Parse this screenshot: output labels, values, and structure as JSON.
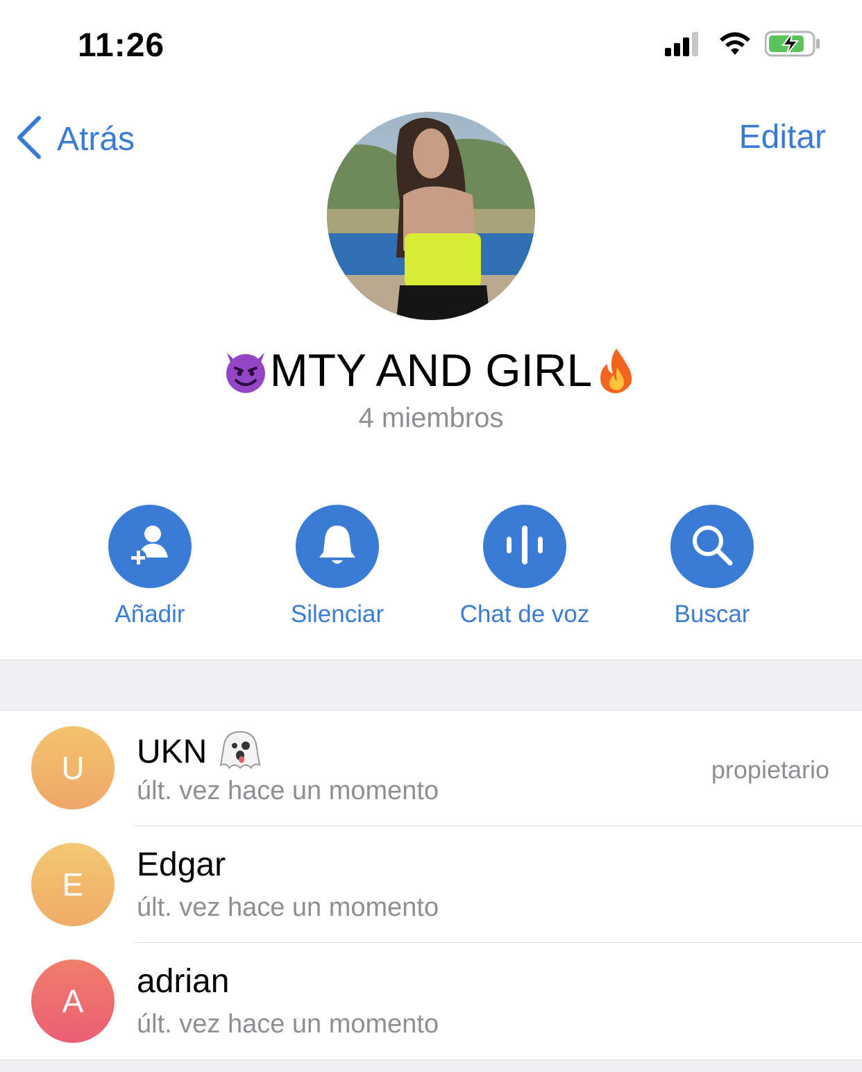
{
  "status_bar": {
    "time": "11:26"
  },
  "nav": {
    "back_label": "Atrás",
    "edit_label": "Editar"
  },
  "group": {
    "title": "MTY AND GIRL",
    "title_emoji_before": "smiling-devil-emoji",
    "title_emoji_after": "fire-emoji",
    "members_count": "4 miembros"
  },
  "actions": [
    {
      "label": "Añadir",
      "icon": "add-user-icon"
    },
    {
      "label": "Silenciar",
      "icon": "bell-icon"
    },
    {
      "label": "Chat de voz",
      "icon": "voice-chat-icon"
    },
    {
      "label": "Buscar",
      "icon": "search-icon"
    }
  ],
  "members": [
    {
      "initial": "U",
      "name": "UKN",
      "name_emoji": "ghost-emoji",
      "status": "últ. vez hace un momento",
      "role": "propietario",
      "color": "#f0b56a"
    },
    {
      "initial": "E",
      "name": "Edgar",
      "status": "últ. vez hace un momento",
      "role": "",
      "color": "#f2ba6b"
    },
    {
      "initial": "A",
      "name": "adrian",
      "status": "últ. vez hace un momento",
      "role": "",
      "color": "#ec6b6b"
    }
  ],
  "colors": {
    "accent": "#3a7bd5",
    "secondary_text": "#8e8e93",
    "separator_bg": "#efeff4"
  }
}
